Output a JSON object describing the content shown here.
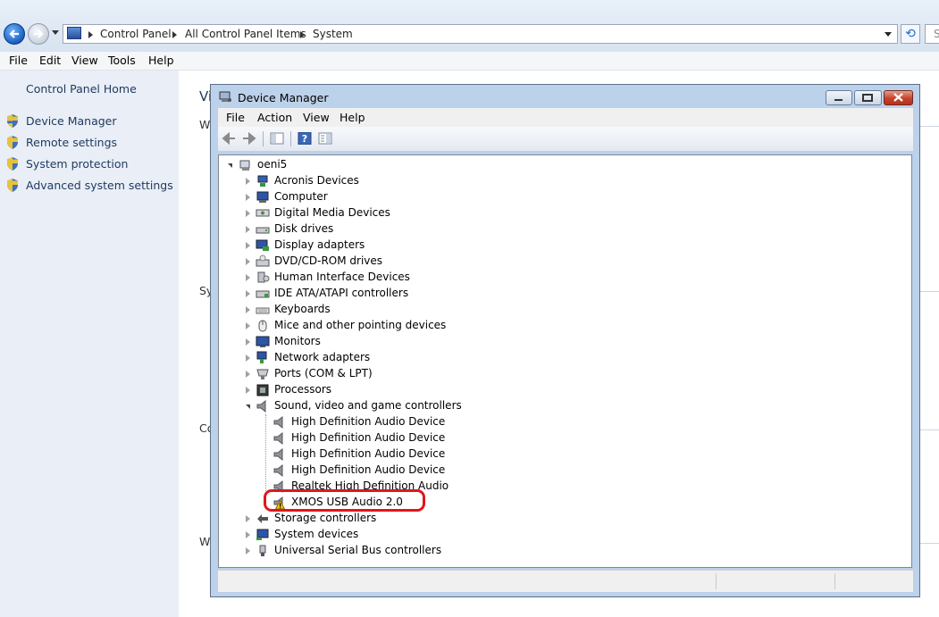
{
  "explorer": {
    "breadcrumb": [
      "Control Panel",
      "All Control Panel Items",
      "System"
    ],
    "search_placeholder": "S",
    "menu": [
      "File",
      "Edit",
      "View",
      "Tools",
      "Help"
    ],
    "left_panel": {
      "home": "Control Panel Home",
      "links": [
        "Device Manager",
        "Remote settings",
        "System protection",
        "Advanced system settings"
      ]
    },
    "content_fragments": [
      "Vi",
      "W",
      "Sy",
      "Co",
      "W"
    ]
  },
  "device_manager": {
    "title": "Device Manager",
    "menu": [
      "File",
      "Action",
      "View",
      "Help"
    ],
    "root": "oeni5",
    "categories": [
      {
        "label": "Acronis Devices",
        "icon": "acronis-icon"
      },
      {
        "label": "Computer",
        "icon": "computer-icon"
      },
      {
        "label": "Digital Media Devices",
        "icon": "media-icon"
      },
      {
        "label": "Disk drives",
        "icon": "disk-icon"
      },
      {
        "label": "Display adapters",
        "icon": "display-icon"
      },
      {
        "label": "DVD/CD-ROM drives",
        "icon": "dvd-icon"
      },
      {
        "label": "Human Interface Devices",
        "icon": "hid-icon"
      },
      {
        "label": "IDE ATA/ATAPI controllers",
        "icon": "ide-icon"
      },
      {
        "label": "Keyboards",
        "icon": "keyboard-icon"
      },
      {
        "label": "Mice and other pointing devices",
        "icon": "mouse-icon"
      },
      {
        "label": "Monitors",
        "icon": "monitor-icon"
      },
      {
        "label": "Network adapters",
        "icon": "network-icon"
      },
      {
        "label": "Ports (COM & LPT)",
        "icon": "port-icon"
      },
      {
        "label": "Processors",
        "icon": "processor-icon"
      },
      {
        "label": "Sound, video and game controllers",
        "icon": "speaker-icon"
      }
    ],
    "sound_children": [
      "High Definition Audio Device",
      "High Definition Audio Device",
      "High Definition Audio Device",
      "High Definition Audio Device",
      "Realtek High Definition Audio",
      "XMOS USB Audio 2.0"
    ],
    "categories_after": [
      {
        "label": "Storage controllers",
        "icon": "storage-icon"
      },
      {
        "label": "System devices",
        "icon": "system-icon"
      },
      {
        "label": "Universal Serial Bus controllers",
        "icon": "usb-icon"
      }
    ],
    "highlight_color": "#e0161d"
  }
}
